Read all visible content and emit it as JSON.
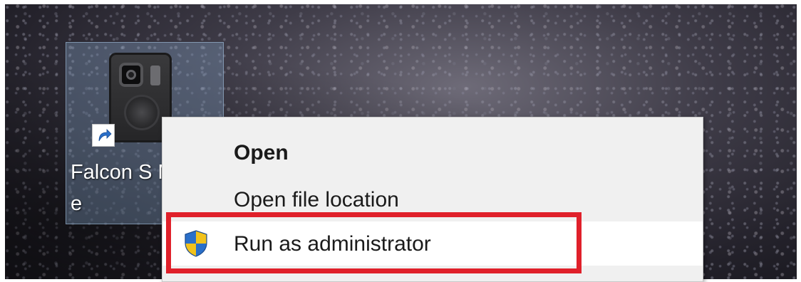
{
  "desktop": {
    "shortcut": {
      "label": "Falcon S Manage",
      "icon": "body-camera-device-icon",
      "badge_icon": "shortcut-arrow-icon"
    }
  },
  "context_menu": {
    "items": [
      {
        "label": "Open",
        "bold": true
      },
      {
        "label": "Open file location",
        "bold": false
      },
      {
        "label": "Run as administrator",
        "icon": "uac-shield-icon",
        "hovered": true
      }
    ]
  },
  "annotation": {
    "highlight_color": "#e0202a",
    "target": "Run as administrator"
  },
  "colors": {
    "menu_background": "#f0f0f0",
    "hover_background": "#ffffff",
    "selection_tint": "#7d9bbe",
    "shield_blue": "#2a6fc9",
    "shield_yellow": "#f2c21b"
  }
}
